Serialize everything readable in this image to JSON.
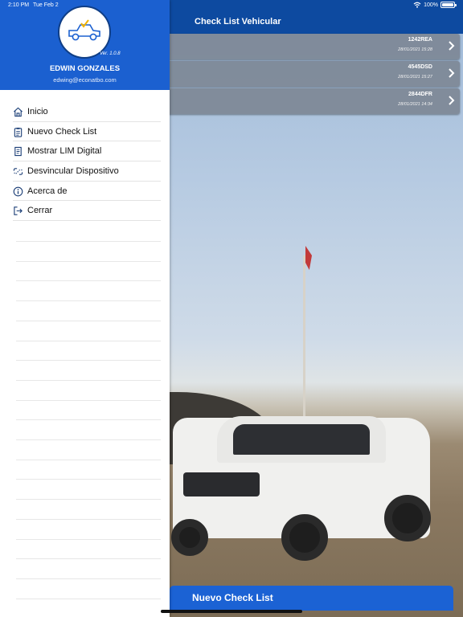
{
  "status_bar": {
    "time": "2:10 PM",
    "date": "Tue Feb 2",
    "battery": "100%",
    "battery_level": 1.0
  },
  "header": {
    "title": "Check List Vehicular"
  },
  "checklists": [
    {
      "plate": "1242REA",
      "datetime": "28/01/2021 15:28"
    },
    {
      "plate": "4545DSD",
      "datetime": "28/01/2021 15:27"
    },
    {
      "plate": "2844DFR",
      "datetime": "28/01/2021 14:34"
    }
  ],
  "primary_button": {
    "label": "Nuevo Check List"
  },
  "drawer": {
    "version": "Ver. 1.0.8",
    "user_name": "EDWIN GONZALES",
    "user_email": "edwing@econatbo.com",
    "menu": [
      {
        "label": "Inicio",
        "icon": "home-icon"
      },
      {
        "label": "Nuevo Check List",
        "icon": "clipboard-icon"
      },
      {
        "label": "Mostrar LIM Digital",
        "icon": "document-icon"
      },
      {
        "label": "Desvincular Dispositivo",
        "icon": "unlink-icon"
      },
      {
        "label": "Acerca de",
        "icon": "info-icon"
      },
      {
        "label": "Cerrar",
        "icon": "logout-icon"
      }
    ]
  },
  "colors": {
    "drawer_header": "#1b60d0",
    "top_bar": "#0d4aa0",
    "primary_button": "#1b62d4"
  }
}
